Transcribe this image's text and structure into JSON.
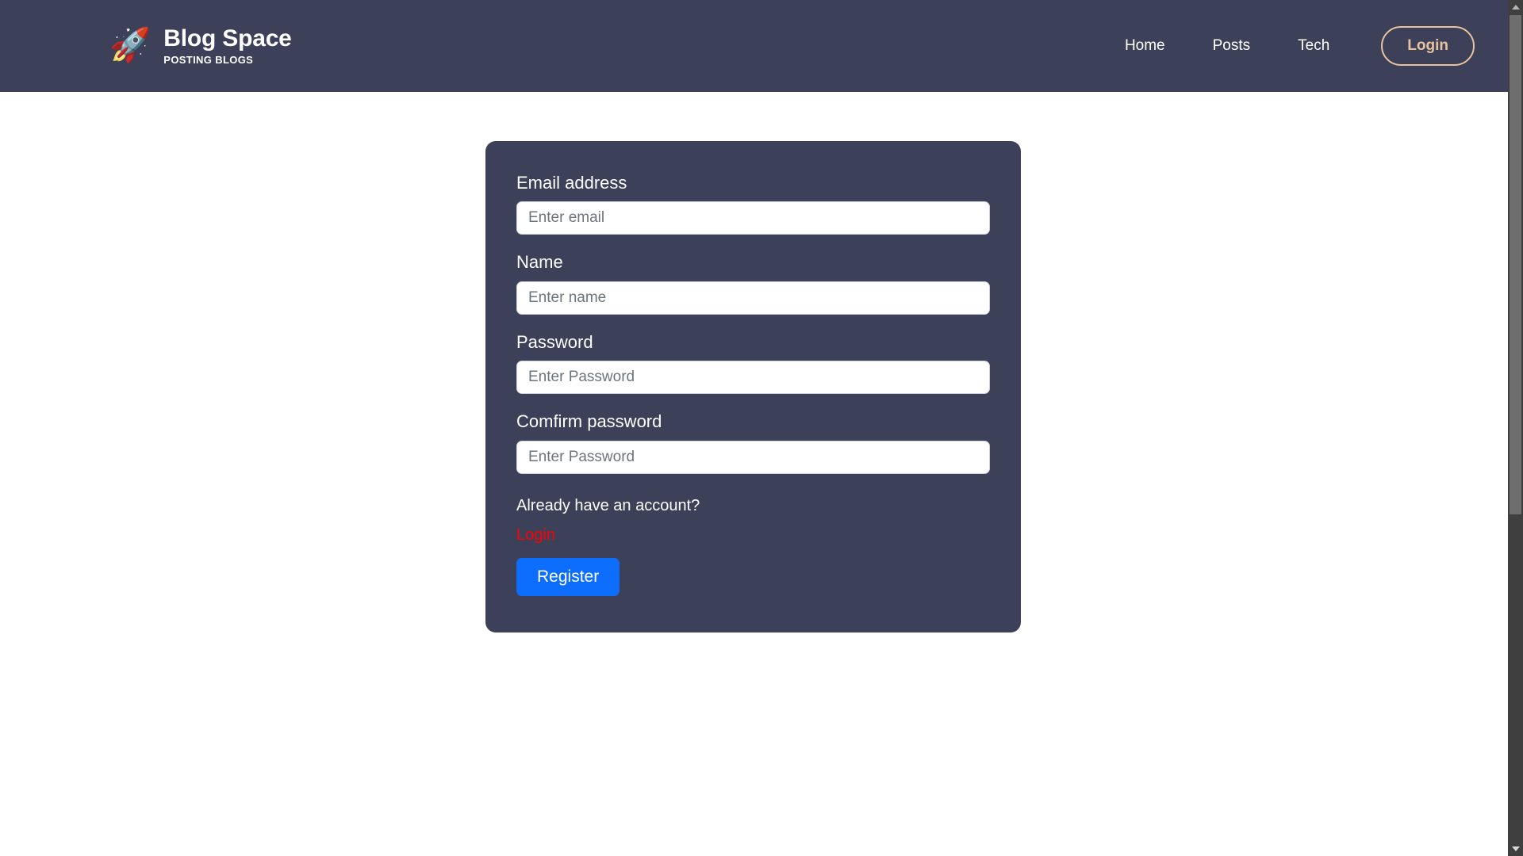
{
  "header": {
    "logo_icon": "rocket-icon",
    "logo_glyph": "🚀",
    "brand_title": "Blog Space",
    "brand_subtitle": "POSTING BLOGS",
    "background_color": "#3d4059",
    "nav_links": [
      {
        "label": "Home"
      },
      {
        "label": "Posts"
      },
      {
        "label": "Tech"
      }
    ],
    "login_button": {
      "label": "Login",
      "border_color": "#e9c39d",
      "text_color": "#e9c39d"
    }
  },
  "register_card": {
    "background_color": "#3d4059",
    "fields": [
      {
        "label": "Email address",
        "placeholder": "Enter email",
        "value": "",
        "type": "email"
      },
      {
        "label": "Name",
        "placeholder": "Enter name",
        "value": "",
        "type": "text"
      },
      {
        "label": "Password",
        "placeholder": "Enter Password",
        "value": "",
        "type": "password"
      },
      {
        "label": "Comfirm password",
        "placeholder": "Enter Password",
        "value": "",
        "type": "password"
      }
    ],
    "account_prompt": "Already have an account?",
    "login_link": {
      "label": "Login",
      "color": "#ff0000"
    },
    "submit_button": {
      "label": "Register",
      "color": "#0d6efd"
    }
  },
  "scrollbar": {
    "up_arrow_icon": "chevron-up-icon",
    "down_arrow_icon": "chevron-down-icon"
  }
}
